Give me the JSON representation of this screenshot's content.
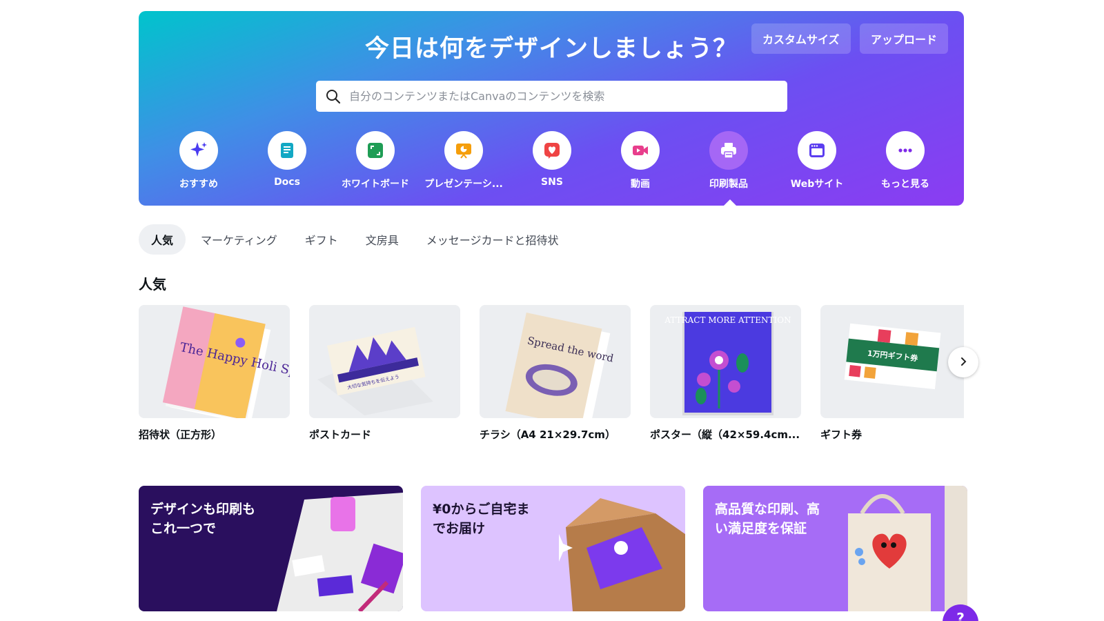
{
  "hero": {
    "title": "今日は何をデザインしましょう？",
    "custom_size_label": "カスタムサイズ",
    "upload_label": "アップロード",
    "search_placeholder": "自分のコンテンツまたはCanvaのコンテンツを検索",
    "categories": [
      {
        "label": "おすすめ",
        "icon": "sparkle-icon",
        "color": "#4a3cf0"
      },
      {
        "label": "Docs",
        "icon": "doc-icon",
        "color": "#12a8c4"
      },
      {
        "label": "ホワイトボード",
        "icon": "whiteboard-icon",
        "color": "#1f9d55"
      },
      {
        "label": "プレゼンテーシ...",
        "icon": "presentation-icon",
        "color": "#f59e0b"
      },
      {
        "label": "SNS",
        "icon": "heart-icon",
        "color": "#ef4444"
      },
      {
        "label": "動画",
        "icon": "video-icon",
        "color": "#e83e8c"
      },
      {
        "label": "印刷製品",
        "icon": "printer-icon",
        "color": "#ffffff"
      },
      {
        "label": "Webサイト",
        "icon": "website-icon",
        "color": "#5b3ef0"
      },
      {
        "label": "もっと見る",
        "icon": "more-icon",
        "color": "#7d2ae8"
      }
    ],
    "active_category": "印刷製品"
  },
  "tabs": [
    "人気",
    "マーケティング",
    "ギフト",
    "文房具",
    "メッセージカードと招待状"
  ],
  "active_tab": "人気",
  "section": {
    "title": "人気"
  },
  "cards": [
    {
      "caption": "招待状（正方形）",
      "thumb_text": "The Happy Holi Spree"
    },
    {
      "caption": "ポストカード",
      "thumb_text": "大切な気持ちを伝えよう"
    },
    {
      "caption": "チラシ（A4 21×29.7cm）",
      "thumb_text": "Spread the word"
    },
    {
      "caption": "ポスター（縦（42×59.4cm...",
      "thumb_text": "ATTRACT MORE ATTENTION"
    },
    {
      "caption": "ギフト券",
      "thumb_text": "1万円ギフト券"
    }
  ],
  "promos": [
    {
      "text": "デザインも印刷も\nこれ一つで"
    },
    {
      "text": "¥0からご自宅ま\nでお届け"
    },
    {
      "text": "高品質な印刷、高\nい満足度を保証"
    }
  ],
  "help_label": "?",
  "colors": {
    "accent": "#7d2ae8",
    "gradient_start": "#00c4cc",
    "gradient_end": "#8b3cf2"
  }
}
